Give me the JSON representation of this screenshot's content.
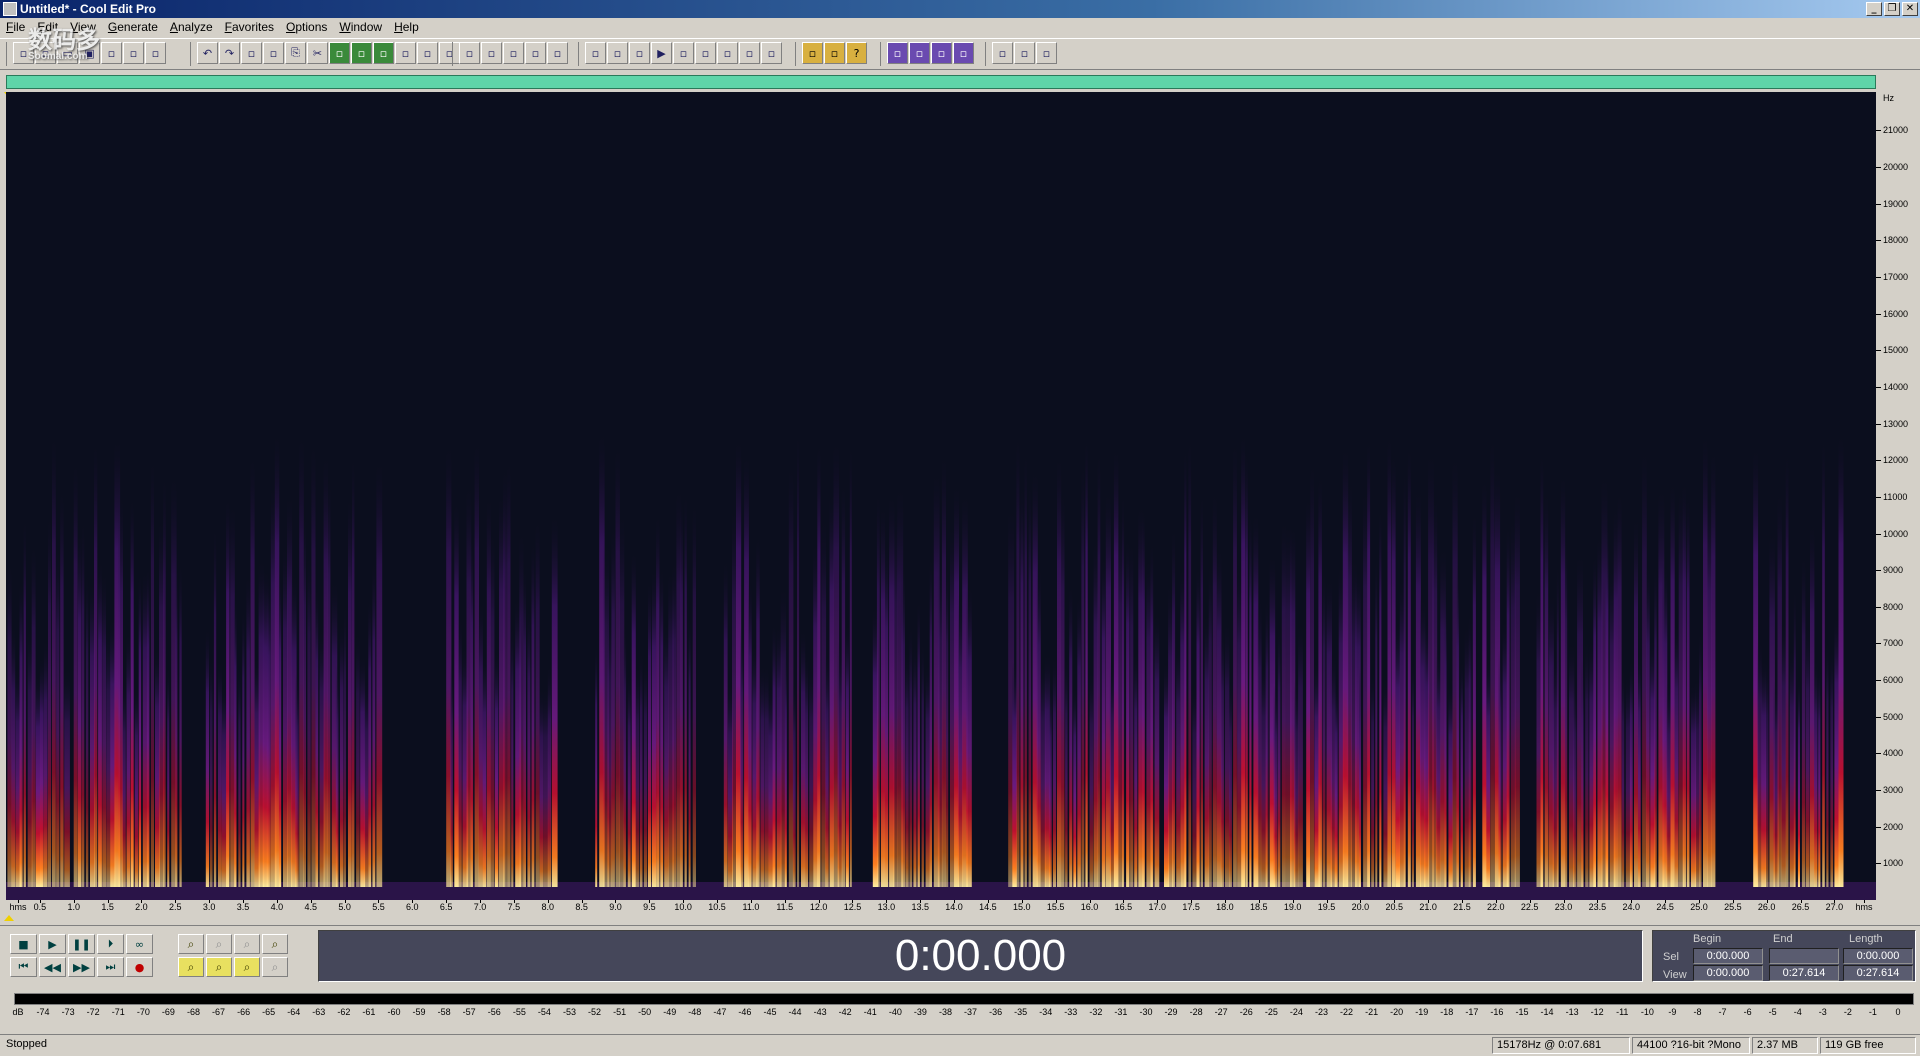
{
  "window": {
    "title": "Untitled* - Cool Edit Pro",
    "controls": [
      "minimize",
      "restore",
      "close"
    ]
  },
  "menu": [
    "File",
    "Edit",
    "View",
    "Generate",
    "Analyze",
    "Favorites",
    "Options",
    "Window",
    "Help"
  ],
  "watermark": {
    "line1": "数码多",
    "line2": "Soomal.com"
  },
  "toolbar": {
    "groups": [
      [
        "multitrack-view-icon",
        "edit-view-icon",
        "open-file-icon",
        "save-file-icon",
        "new-file-icon",
        "close-file-icon",
        "properties-icon"
      ],
      [
        "undo-icon",
        "redo-icon",
        "repeat-icon",
        "copy-new-icon",
        "copy-icon",
        "cut-icon",
        "paste-icon",
        "paste-new-icon",
        "mix-paste-icon",
        "crop-icon",
        "trim-icon",
        "convert-icon"
      ],
      [
        "waveform-view-icon",
        "spectral-view-icon",
        "grid-view-icon",
        "list-view-icon",
        "meter-view-icon"
      ],
      [
        "cue-list-icon",
        "play-list-icon",
        "snap-icon",
        "play-icon",
        "zoom-view-icon",
        "time-display-icon",
        "frames-icon",
        "level-meter-icon",
        "info-icon"
      ],
      [
        "effects-icon",
        "favorites-icon",
        "help-icon"
      ],
      [
        "amplify-icon",
        "envelope-icon",
        "normalize-icon",
        "stretch-icon"
      ],
      [
        "graphic-eq-icon",
        "filter-icon",
        "noise-reduction-icon"
      ]
    ]
  },
  "spectral": {
    "unit_label": "Hz",
    "freq_labels": [
      "21000",
      "20000",
      "19000",
      "18000",
      "17000",
      "16000",
      "15000",
      "14000",
      "13000",
      "12000",
      "11000",
      "10000",
      "9000",
      "8000",
      "7000",
      "6000",
      "5000",
      "4000",
      "3000",
      "2000",
      "1000"
    ],
    "time_labels": [
      "hms",
      "0.5",
      "1.0",
      "1.5",
      "2.0",
      "2.5",
      "3.0",
      "3.5",
      "4.0",
      "4.5",
      "5.0",
      "5.5",
      "6.0",
      "6.5",
      "7.0",
      "7.5",
      "8.0",
      "8.5",
      "9.0",
      "9.5",
      "10.0",
      "10.5",
      "11.0",
      "11.5",
      "12.0",
      "12.5",
      "13.0",
      "13.5",
      "14.0",
      "14.5",
      "15.0",
      "15.5",
      "16.0",
      "16.5",
      "17.0",
      "17.5",
      "18.0",
      "18.5",
      "19.0",
      "19.5",
      "20.0",
      "20.5",
      "21.0",
      "21.5",
      "22.0",
      "22.5",
      "23.0",
      "23.5",
      "24.0",
      "24.5",
      "25.0",
      "25.5",
      "26.0",
      "26.5",
      "27.0",
      "hms"
    ],
    "duration_s": 27.614,
    "max_freq_hz": 22050,
    "colors": {
      "background": "#0b0e1e",
      "low": "#4b1a6e",
      "mid": "#c01030",
      "high": "#ff8020",
      "peak": "#fff0a0"
    }
  },
  "transport": {
    "row1": [
      "stop-icon",
      "play-icon",
      "pause-icon",
      "play-to-end-icon",
      "loop-icon"
    ],
    "row2": [
      "go-to-start-icon",
      "rewind-icon",
      "fast-forward-icon",
      "go-to-end-icon",
      "record-icon"
    ]
  },
  "zoom": {
    "row1": [
      "zoom-in-icon",
      "zoom-out-icon",
      "zoom-full-icon",
      "zoom-selection-icon"
    ],
    "row2": [
      "zoom-left-icon",
      "zoom-right-icon",
      "zoom-in-vertical-icon",
      "zoom-out-vertical-icon"
    ]
  },
  "clock": {
    "time": "0:00.000"
  },
  "selection": {
    "headers": {
      "begin": "Begin",
      "end": "End",
      "length": "Length"
    },
    "sel": {
      "label": "Sel",
      "begin": "0:00.000",
      "end": "",
      "length": "0:00.000"
    },
    "view": {
      "label": "View",
      "begin": "0:00.000",
      "end": "0:27.614",
      "length": "0:27.614"
    }
  },
  "level_meter": {
    "labels": [
      "dB",
      "-74",
      "-73",
      "-72",
      "-71",
      "-70",
      "-69",
      "-68",
      "-67",
      "-66",
      "-65",
      "-64",
      "-63",
      "-62",
      "-61",
      "-60",
      "-59",
      "-58",
      "-57",
      "-56",
      "-55",
      "-54",
      "-53",
      "-52",
      "-51",
      "-50",
      "-49",
      "-48",
      "-47",
      "-46",
      "-45",
      "-44",
      "-43",
      "-42",
      "-41",
      "-40",
      "-39",
      "-38",
      "-37",
      "-36",
      "-35",
      "-34",
      "-33",
      "-32",
      "-31",
      "-30",
      "-29",
      "-28",
      "-27",
      "-26",
      "-25",
      "-24",
      "-23",
      "-22",
      "-21",
      "-20",
      "-19",
      "-18",
      "-17",
      "-16",
      "-15",
      "-14",
      "-13",
      "-12",
      "-11",
      "-10",
      "-9",
      "-8",
      "-7",
      "-6",
      "-5",
      "-4",
      "-3",
      "-2",
      "-1",
      "0"
    ]
  },
  "status": {
    "state": "Stopped",
    "cursor": "15178Hz @  0:07.681",
    "format": "44100 ?16-bit ?Mono",
    "size": "2.37 MB",
    "free": "119 GB free"
  }
}
